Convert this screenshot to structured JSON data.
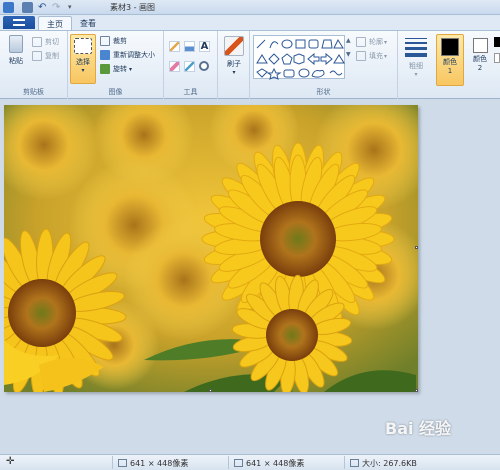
{
  "window": {
    "title": "素材3 - 画图"
  },
  "tabs": [
    {
      "label": "主页"
    },
    {
      "label": "查看"
    }
  ],
  "clipboard": {
    "paste": "粘贴",
    "cut": "剪切",
    "copy": "复制",
    "group": "剪贴板"
  },
  "image": {
    "select": "选择",
    "crop": "裁剪",
    "resize": "重新调整大小",
    "rotate": "旋转",
    "group": "图像"
  },
  "tools": {
    "group": "工具",
    "text_tool": "A"
  },
  "brushes": {
    "label": "刷子"
  },
  "shapes": {
    "outline": "轮廓",
    "fill": "填充",
    "group": "形状"
  },
  "size": {
    "label": "粗细"
  },
  "colors": {
    "color1_label": "颜色 1",
    "color2_label": "颜色 2",
    "color1": "#000000",
    "color2": "#ffffff"
  },
  "accent": {
    "selected": "#f8c661",
    "ribbon": "#dde8f4"
  },
  "status": {
    "cursor_icon": "move-cursor-icon",
    "selection_size": "641 × 448像素",
    "image_size": "641 × 448像素",
    "file_size": "大小: 267.6KB"
  },
  "watermark": "Bai 经验"
}
